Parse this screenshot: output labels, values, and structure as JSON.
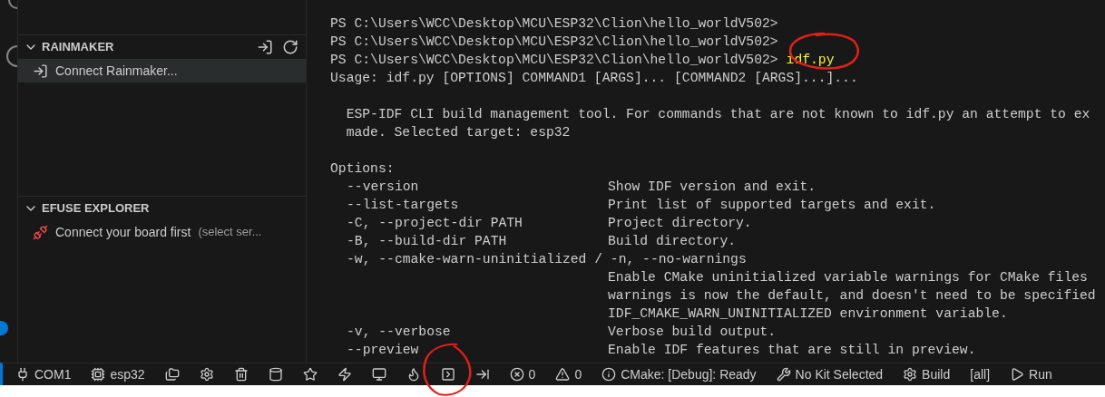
{
  "sidebar": {
    "sections": [
      {
        "title": "RAINMAKER",
        "expanded": true,
        "actions": [
          {
            "kind": "login"
          },
          {
            "kind": "refresh"
          }
        ],
        "items": [
          {
            "kind": "login",
            "label": "Connect Rainmaker...",
            "selected": true
          }
        ]
      },
      {
        "title": "EFUSE EXPLORER",
        "expanded": true,
        "items": [
          {
            "kind": "plug",
            "label": "Connect your board first",
            "hint": "(select ser...",
            "selected": false
          }
        ]
      }
    ]
  },
  "terminal": {
    "lines": [
      {
        "kind": "prompt",
        "text": "PS C:\\Users\\WCC\\Desktop\\MCU\\ESP32\\Clion\\hello_worldV502>"
      },
      {
        "kind": "prompt",
        "text": "PS C:\\Users\\WCC\\Desktop\\MCU\\ESP32\\Clion\\hello_worldV502>"
      },
      {
        "kind": "prompt",
        "text": "PS C:\\Users\\WCC\\Desktop\\MCU\\ESP32\\Clion\\hello_worldV502>",
        "command": "idf.py"
      },
      {
        "kind": "text",
        "text": "Usage: idf.py [OPTIONS] COMMAND1 [ARGS]... [COMMAND2 [ARGS]...]..."
      },
      {
        "kind": "blank"
      },
      {
        "kind": "text",
        "text": "  ESP-IDF CLI build management tool. For commands that are not known to idf.py an attempt to ex"
      },
      {
        "kind": "text",
        "text": "  made. Selected target: esp32"
      },
      {
        "kind": "blank"
      },
      {
        "kind": "text",
        "text": "Options:"
      },
      {
        "kind": "option",
        "option": "--version",
        "description": "Show IDF version and exit."
      },
      {
        "kind": "option",
        "option": "--list-targets",
        "description": "Print list of supported targets and exit."
      },
      {
        "kind": "option",
        "option": "-C, --project-dir PATH",
        "description": "Project directory."
      },
      {
        "kind": "option",
        "option": "-B, --build-dir PATH",
        "description": "Build directory."
      },
      {
        "kind": "option",
        "option": "-w, --cmake-warn-uninitialized / -n, --no-warnings"
      },
      {
        "kind": "option",
        "description": "Enable CMake uninitialized variable warnings for CMake files"
      },
      {
        "kind": "option",
        "description": "warnings is now the default, and doesn't need to be specified"
      },
      {
        "kind": "option",
        "description": "IDF_CMAKE_WARN_UNINITIALIZED environment variable."
      },
      {
        "kind": "option",
        "option": "-v, --verbose",
        "description": "Verbose build output."
      },
      {
        "kind": "option",
        "option": "--preview",
        "description": "Enable IDF features that are still in preview."
      }
    ]
  },
  "status_bar": {
    "items": [
      {
        "kind": "port",
        "text": "COM1"
      },
      {
        "kind": "chip",
        "text": "esp32"
      },
      {
        "kind": "folder"
      },
      {
        "kind": "settings"
      },
      {
        "kind": "trash"
      },
      {
        "kind": "database"
      },
      {
        "kind": "star"
      },
      {
        "kind": "flash"
      },
      {
        "kind": "monitor"
      },
      {
        "kind": "flame"
      },
      {
        "kind": "terminal"
      },
      {
        "kind": "enter"
      },
      {
        "kind": "errors",
        "text": "0"
      },
      {
        "kind": "warnings",
        "text": "0"
      },
      {
        "kind": "info",
        "text": "CMake: [Debug]: Ready"
      },
      {
        "kind": "tools",
        "text": "No Kit Selected"
      },
      {
        "kind": "settings",
        "text": "Build"
      },
      {
        "kind": "plain",
        "text": "[all]"
      },
      {
        "kind": "run",
        "text": "Run"
      }
    ]
  }
}
